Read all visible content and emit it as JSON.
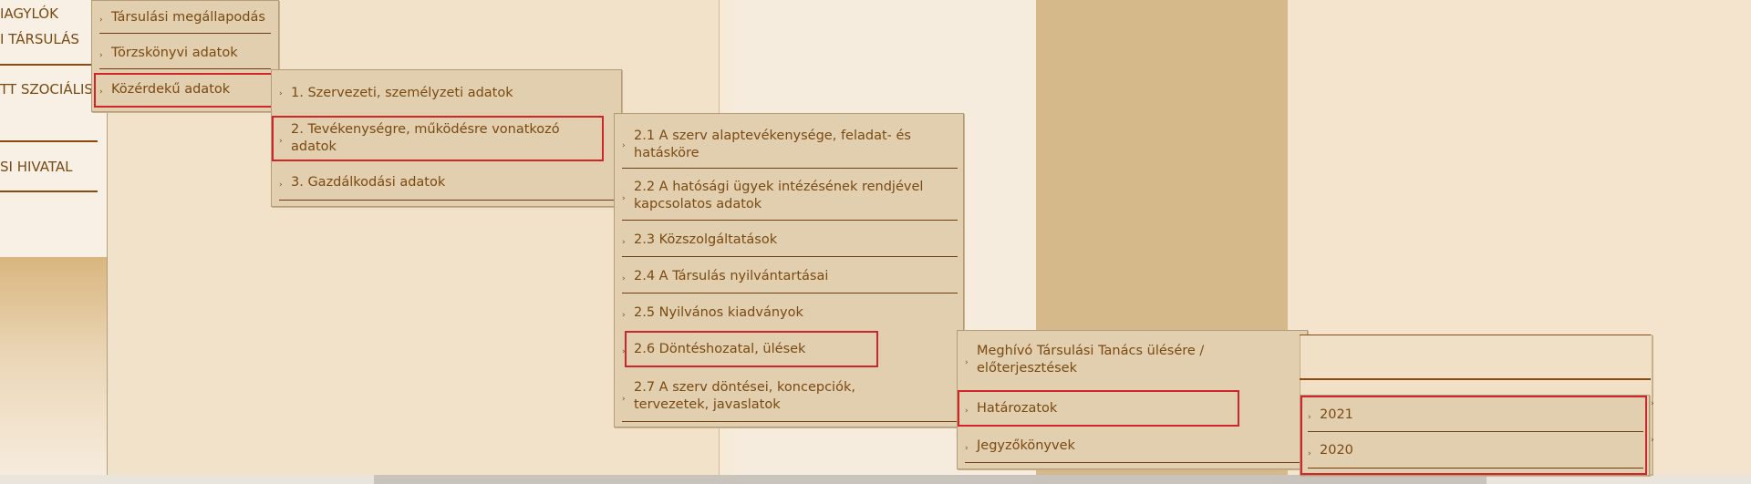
{
  "colors": {
    "accent_text": "#7a4a12",
    "menu_bg": "#e2cfaf",
    "highlight_border": "#d0252b",
    "pillar": "#d6b98a"
  },
  "icons": {
    "submenu_arrow": "chevron-right-icon"
  },
  "left_nav": {
    "items": [
      "IAGYLÓK",
      "I TÁRSULÁS",
      "TT SZOCIÁLIS",
      "SI HIVATAL"
    ]
  },
  "menu1": {
    "items": [
      "Társulási megállapodás",
      "Törzskönyvi adatok",
      "Közérdekű adatok"
    ],
    "highlighted": "Közérdekű adatok"
  },
  "menu2": {
    "items": [
      "1. Szervezeti, személyzeti adatok",
      "2. Tevékenységre, működésre vonatkozó adatok",
      "3. Gazdálkodási adatok"
    ],
    "highlighted": "2. Tevékenységre, működésre vonatkozó adatok"
  },
  "menu3": {
    "items": [
      "2.1 A szerv alaptevékenysége, feladat- és hatásköre",
      "2.2 A hatósági ügyek intézésének rendjével kapcsolatos adatok",
      "2.3 Közszolgáltatások",
      "2.4 A Társulás nyilvántartásai",
      "2.5 Nyilvános kiadványok",
      "2.6 Döntéshozatal, ülések",
      "2.7 A szerv döntései, koncepciók, tervezetek, javaslatok"
    ],
    "highlighted": "2.6 Döntéshozatal, ülések"
  },
  "menu4": {
    "items": [
      "Meghívó Társulási Tanács ülésére / előterjesztések",
      "Határozatok",
      "Jegyzőkönyvek"
    ],
    "highlighted": "Határozatok"
  },
  "menu5": {
    "items": [
      "2021",
      "2020"
    ],
    "highlighted": [
      "2021",
      "2020"
    ]
  }
}
